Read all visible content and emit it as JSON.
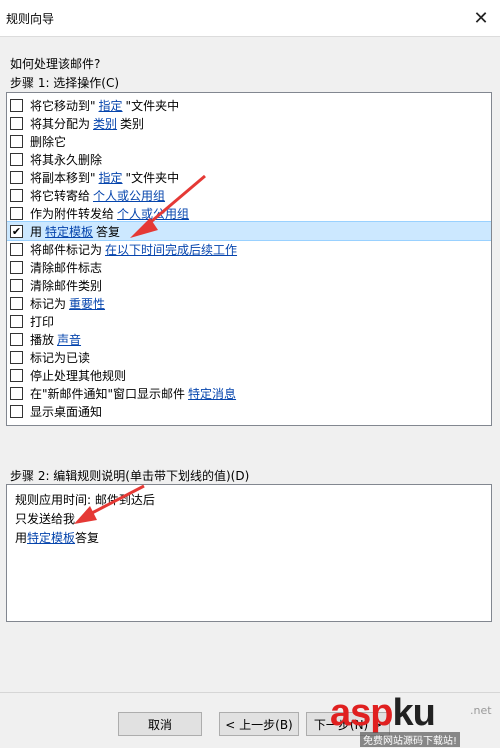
{
  "window": {
    "title": "规则向导",
    "close_glyph": "✕"
  },
  "question": "如何处理该邮件?",
  "step1": {
    "label": "步骤 1: 选择操作(C)",
    "items": [
      {
        "parts": [
          {
            "t": "将它移动到\""
          },
          {
            "t": "指定",
            "link": true
          },
          {
            "t": "\"文件夹中"
          }
        ],
        "checked": false
      },
      {
        "parts": [
          {
            "t": "将其分配为"
          },
          {
            "t": "类别",
            "link": true
          },
          {
            "t": "类别"
          }
        ],
        "checked": false
      },
      {
        "parts": [
          {
            "t": "删除它"
          }
        ],
        "checked": false
      },
      {
        "parts": [
          {
            "t": "将其永久删除"
          }
        ],
        "checked": false
      },
      {
        "parts": [
          {
            "t": "将副本移到\""
          },
          {
            "t": "指定",
            "link": true
          },
          {
            "t": "\"文件夹中"
          }
        ],
        "checked": false
      },
      {
        "parts": [
          {
            "t": "将它转寄给"
          },
          {
            "t": "个人或公用组",
            "link": true
          }
        ],
        "checked": false
      },
      {
        "parts": [
          {
            "t": "作为附件转发给"
          },
          {
            "t": "个人或公用组",
            "link": true
          }
        ],
        "checked": false
      },
      {
        "parts": [
          {
            "t": "用"
          },
          {
            "t": "特定模板",
            "link": true
          },
          {
            "t": "答复"
          }
        ],
        "checked": true,
        "selected": true
      },
      {
        "parts": [
          {
            "t": "将邮件标记为"
          },
          {
            "t": "在以下时间完成后续工作",
            "link": true
          }
        ],
        "checked": false
      },
      {
        "parts": [
          {
            "t": "清除邮件标志"
          }
        ],
        "checked": false
      },
      {
        "parts": [
          {
            "t": "清除邮件类别"
          }
        ],
        "checked": false
      },
      {
        "parts": [
          {
            "t": "标记为"
          },
          {
            "t": "重要性",
            "link": true
          }
        ],
        "checked": false
      },
      {
        "parts": [
          {
            "t": "打印"
          }
        ],
        "checked": false
      },
      {
        "parts": [
          {
            "t": "播放"
          },
          {
            "t": "声音",
            "link": true
          }
        ],
        "checked": false
      },
      {
        "parts": [
          {
            "t": "标记为已读"
          }
        ],
        "checked": false
      },
      {
        "parts": [
          {
            "t": "停止处理其他规则"
          }
        ],
        "checked": false
      },
      {
        "parts": [
          {
            "t": "在\"新邮件通知\"窗口显示邮件"
          },
          {
            "t": "特定消息",
            "link": true
          }
        ],
        "checked": false
      },
      {
        "parts": [
          {
            "t": "显示桌面通知"
          }
        ],
        "checked": false
      }
    ]
  },
  "step2": {
    "label": "步骤 2: 编辑规则说明(单击带下划线的值)(D)",
    "lines": [
      {
        "parts": [
          {
            "t": "规则应用时间: 邮件到达后"
          }
        ]
      },
      {
        "parts": [
          {
            "t": "只发送给我"
          }
        ]
      },
      {
        "parts": [
          {
            "t": "用"
          },
          {
            "t": "特定模板",
            "link": true
          },
          {
            "t": "答复"
          }
        ]
      }
    ]
  },
  "buttons": {
    "cancel": "取消",
    "back": "< 上一步(B)",
    "next": "下一步(N) >"
  },
  "watermark": {
    "logo_red": "asp",
    "logo_dark": "ku",
    "suffix": ".net",
    "subtitle": "免费网站源码下载站!"
  },
  "colors": {
    "accent_arrow": "#e53935",
    "link": "#0645ad",
    "selection": "#cce8ff"
  }
}
